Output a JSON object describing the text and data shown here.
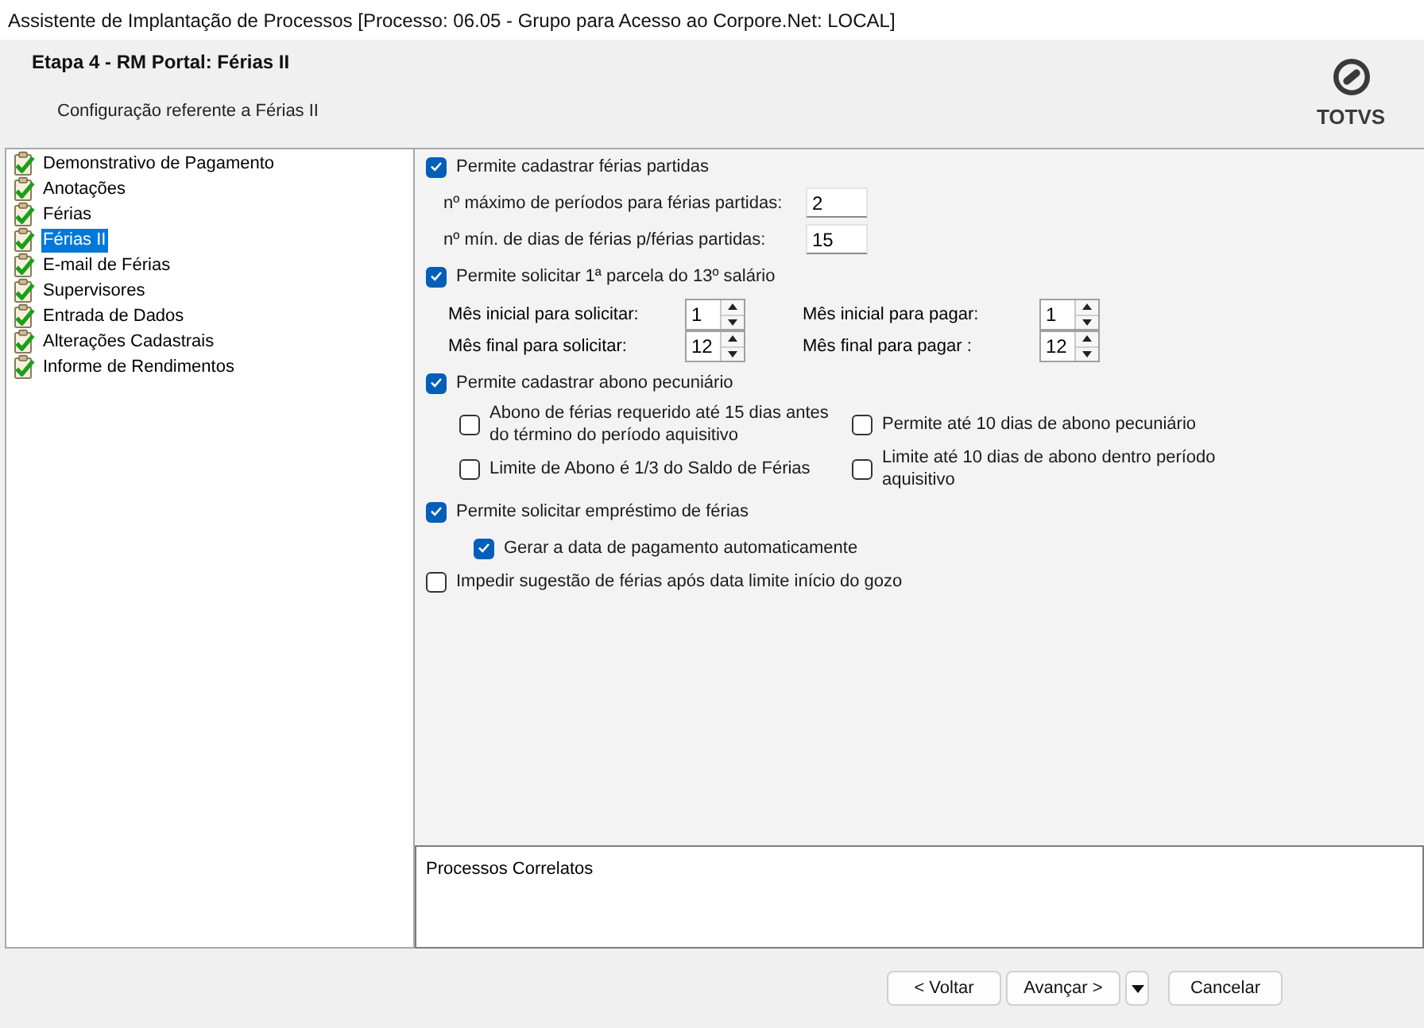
{
  "window": {
    "title": "Assistente de Implantação de Processos [Processo: 06.05 - Grupo para Acesso ao Corpore.Net: LOCAL]"
  },
  "header": {
    "title": "Etapa 4 - RM Portal: Férias II",
    "subtitle": "Configuração referente a Férias II",
    "logo": "TOTVS"
  },
  "steps": [
    {
      "label": "Demonstrativo de Pagamento",
      "selected": false
    },
    {
      "label": "Anotações",
      "selected": false
    },
    {
      "label": "Férias",
      "selected": false
    },
    {
      "label": "Férias II",
      "selected": true
    },
    {
      "label": "E-mail de Férias",
      "selected": false
    },
    {
      "label": "Supervisores",
      "selected": false
    },
    {
      "label": "Entrada de Dados",
      "selected": false
    },
    {
      "label": "Alterações Cadastrais",
      "selected": false
    },
    {
      "label": "Informe de Rendimentos",
      "selected": false
    }
  ],
  "options": [
    {
      "kind": "checkbox",
      "label": "Permite cadastrar férias partidas",
      "checked": true,
      "children": [
        {
          "kind": "field",
          "label": "nº máximo de períodos para férias partidas:",
          "value": "2"
        },
        {
          "kind": "field",
          "label": "nº mín. de dias de férias p/férias partidas:",
          "value": "15"
        }
      ]
    },
    {
      "kind": "checkbox",
      "label": "Permite solicitar 1ª parcela do 13º salário",
      "checked": true,
      "children": [
        {
          "kind": "spinner_grid",
          "items": [
            {
              "label": "Mês inicial para solicitar:",
              "value": "1"
            },
            {
              "label": "Mês inicial para pagar:",
              "value": "1"
            },
            {
              "label": "Mês final para solicitar:",
              "value": "12"
            },
            {
              "label": "Mês final para pagar :",
              "value": "12"
            }
          ]
        }
      ]
    },
    {
      "kind": "checkbox",
      "label": "Permite cadastrar abono pecuniário",
      "checked": true,
      "children": [
        {
          "kind": "checkbox_grid",
          "items": [
            {
              "label": "Abono de férias requerido até 15 dias antes do término do período aquisitivo",
              "checked": false
            },
            {
              "label": "Permite até 10 dias de abono pecuniário",
              "checked": false
            },
            {
              "label": "Limite de Abono é 1/3 do Saldo de Férias",
              "checked": false
            },
            {
              "label": "Limite até 10 dias de abono dentro período aquisitivo",
              "checked": false
            }
          ]
        }
      ]
    },
    {
      "kind": "checkbox",
      "label": "Permite solicitar empréstimo de férias",
      "checked": true,
      "children": [
        {
          "kind": "checkbox",
          "label": "Gerar a data de pagamento automaticamente",
          "checked": true
        }
      ]
    },
    {
      "kind": "checkbox",
      "label": "Impedir sugestão de férias após data limite início do gozo",
      "checked": false
    }
  ],
  "related_panel": {
    "title": "Processos Correlatos"
  },
  "buttons": [
    {
      "kind": "button",
      "label": "< Voltar"
    },
    {
      "kind": "button",
      "label": "Avançar >"
    },
    {
      "kind": "dropdown"
    },
    {
      "kind": "button",
      "label": "Cancelar"
    }
  ]
}
